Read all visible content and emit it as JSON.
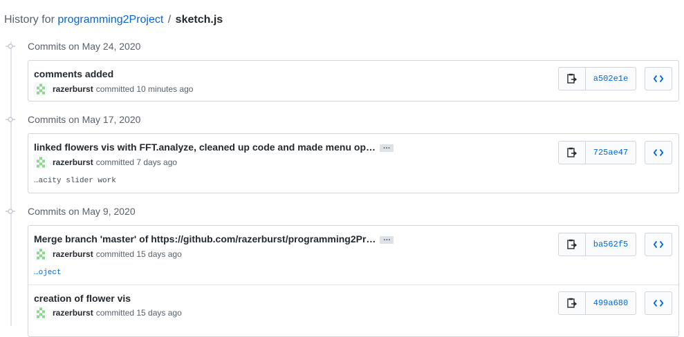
{
  "header": {
    "prefix": "History for",
    "repo": "programming2Project",
    "separator": "/",
    "file": "sketch.js"
  },
  "groups": [
    {
      "title": "Commits on May 24, 2020",
      "commits": [
        {
          "message": "comments added",
          "author": "razerburst",
          "committed_text": "committed 10 minutes ago",
          "sha": "a502e1e"
        }
      ]
    },
    {
      "title": "Commits on May 17, 2020",
      "commits": [
        {
          "message": "linked flowers vis with FFT.analyze, cleaned up code and made menu op…",
          "expand_label": "…",
          "author": "razerburst",
          "committed_text": "committed 7 days ago",
          "description": "…acity slider work",
          "sha": "725ae47"
        }
      ]
    },
    {
      "title": "Commits on May 9, 2020",
      "commits": [
        {
          "message": "Merge branch 'master' of https://github.com/razerburst/programming2Pr…",
          "expand_label": "…",
          "author": "razerburst",
          "committed_text": "committed 15 days ago",
          "description": "…oject",
          "sha": "ba562f5"
        },
        {
          "message": "creation of flower vis",
          "author": "razerburst",
          "committed_text": "committed 15 days ago",
          "sha": "499a680"
        }
      ]
    }
  ],
  "colors": {
    "link": "#0366d6",
    "border": "#d1d5da",
    "muted": "#586069",
    "avatar_green": "#8fd48f"
  },
  "icons": {
    "timeline": "git-commit-icon",
    "copy": "clippy-icon",
    "browse": "code-icon"
  }
}
